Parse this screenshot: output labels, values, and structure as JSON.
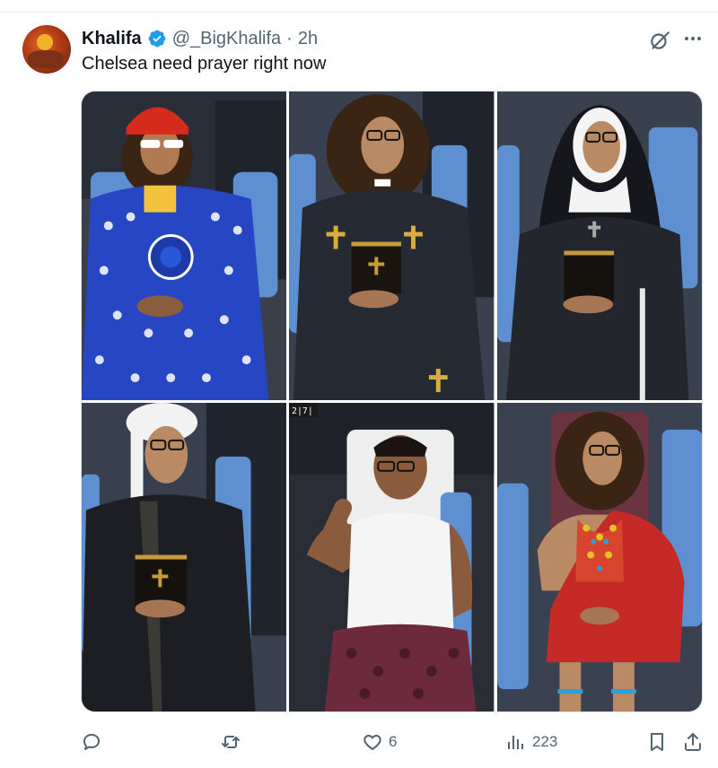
{
  "tweet": {
    "author_name": "Khalifa",
    "handle": "@_BigKhalifa",
    "separator": "·",
    "time": "2h",
    "text": "Chelsea need prayer right now",
    "verified_color": "#1d9bf0"
  },
  "media": {
    "photos": [
      {
        "subject": "Man in Chelsea-crest blue robe with red hard hat and white glasses"
      },
      {
        "subject": "Man dressed as priest holding a bible with gold crosses"
      },
      {
        "subject": "Man dressed as nun holding a bible"
      },
      {
        "subject": "Man in white turban and dark robe holding a bible"
      },
      {
        "subject": "Man in white tank top brushing teeth with toothpick",
        "overlay_text": "2|7|"
      },
      {
        "subject": "Man in red Maasai shuka with beaded necklace"
      }
    ]
  },
  "actions": {
    "reply_icon": "reply-icon",
    "retweet_icon": "retweet-icon",
    "like_icon": "heart-icon",
    "like_count": "6",
    "views_icon": "views-icon",
    "views_count": "223",
    "bookmark_icon": "bookmark-icon",
    "share_icon": "share-icon"
  },
  "colors": {
    "text_primary": "#0f1419",
    "text_secondary": "#536471",
    "accent": "#1d9bf0"
  }
}
